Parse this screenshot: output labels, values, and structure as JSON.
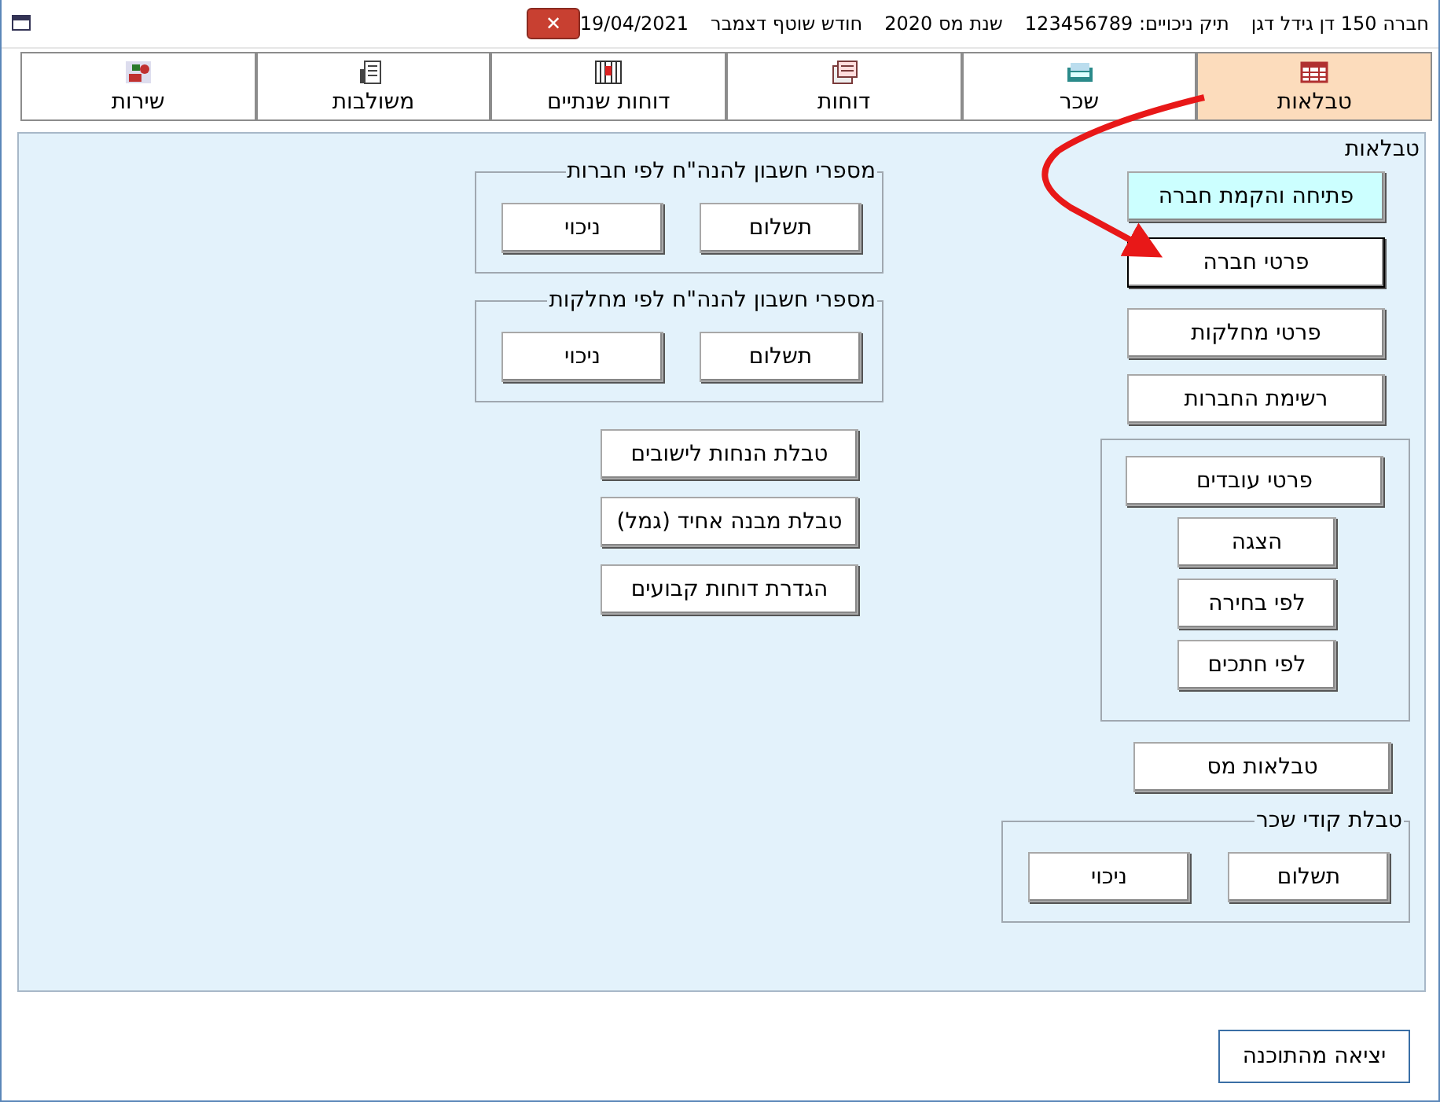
{
  "window": {
    "title_parts": [
      "חברה 150 דן גידל דגן",
      "תיק ניכויים: 123456789",
      "שנת מס 2020",
      "חודש שוטף דצמבר",
      "19/04/2021"
    ],
    "close": "✕"
  },
  "tabs": [
    {
      "label": "טבלאות",
      "selected": true
    },
    {
      "label": "שכר",
      "selected": false
    },
    {
      "label": "דוחות",
      "selected": false
    },
    {
      "label": "דוחות שנתיים",
      "selected": false
    },
    {
      "label": "משולבות",
      "selected": false
    },
    {
      "label": "שירות",
      "selected": false
    }
  ],
  "panel": {
    "title": "טבלאות",
    "right_buttons": [
      {
        "label": "פתיחה והקמת חברה",
        "highlighted": true,
        "focused": false
      },
      {
        "label": "פרטי חברה",
        "highlighted": false,
        "focused": true
      },
      {
        "label": "פרטי מחלקות",
        "highlighted": false,
        "focused": false
      },
      {
        "label": "רשימת החברות",
        "highlighted": false,
        "focused": false
      }
    ],
    "employees_group": {
      "main": "פרטי עובדים",
      "sub_buttons": [
        "הצגה",
        "לפי בחירה",
        "לפי חתכים"
      ]
    },
    "tax_tables": "טבלאות מס",
    "salary_codes": {
      "title": "טבלת קודי שכר",
      "buttons": [
        "תשלום",
        "ניכוי"
      ]
    },
    "groups": [
      {
        "title": "מספרי חשבון להנה\"ח לפי חברות",
        "buttons": [
          "תשלום",
          "ניכוי"
        ]
      },
      {
        "title": "מספרי חשבון להנה\"ח לפי מחלקות",
        "buttons": [
          "תשלום",
          "ניכוי"
        ]
      }
    ],
    "middle_buttons": [
      "טבלת הנחות לישובים",
      "טבלת מבנה אחיד (גמל)",
      "הגדרת דוחות קבועים"
    ]
  },
  "exit_button": "יציאה מהתוכנה"
}
